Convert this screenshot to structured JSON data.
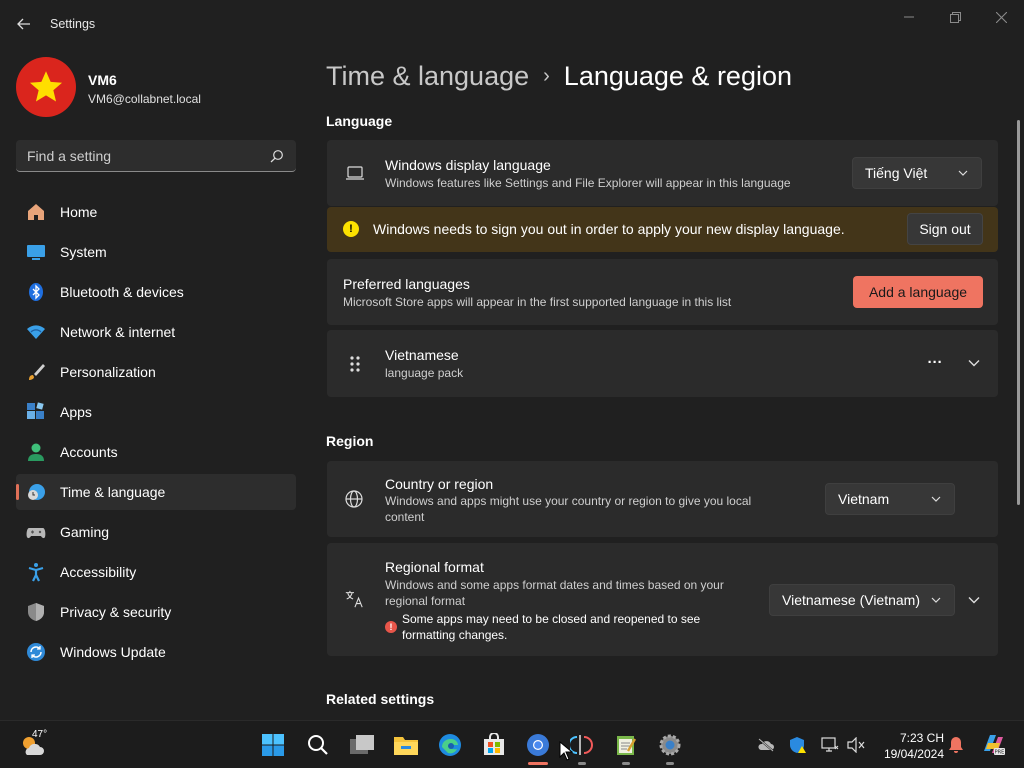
{
  "app": {
    "title": "Settings"
  },
  "user": {
    "name": "VM6",
    "email": "VM6@collabnet.local"
  },
  "search": {
    "placeholder": "Find a setting"
  },
  "sidebar": {
    "items": [
      {
        "label": "Home",
        "icon": "home-icon"
      },
      {
        "label": "System",
        "icon": "system-icon"
      },
      {
        "label": "Bluetooth & devices",
        "icon": "bluetooth-icon"
      },
      {
        "label": "Network & internet",
        "icon": "wifi-icon"
      },
      {
        "label": "Personalization",
        "icon": "brush-icon"
      },
      {
        "label": "Apps",
        "icon": "apps-icon"
      },
      {
        "label": "Accounts",
        "icon": "accounts-icon"
      },
      {
        "label": "Time & language",
        "icon": "time-language-icon",
        "active": true
      },
      {
        "label": "Gaming",
        "icon": "gaming-icon"
      },
      {
        "label": "Accessibility",
        "icon": "accessibility-icon"
      },
      {
        "label": "Privacy & security",
        "icon": "shield-icon"
      },
      {
        "label": "Windows Update",
        "icon": "update-icon"
      }
    ]
  },
  "breadcrumb": {
    "parent": "Time & language",
    "separator": "›",
    "current": "Language & region"
  },
  "language": {
    "section_title": "Language",
    "display": {
      "title": "Windows display language",
      "description": "Windows features like Settings and File Explorer will appear in this language",
      "value": "Tiếng Việt"
    },
    "warning": {
      "text": "Windows needs to sign you out in order to apply your new display language.",
      "button": "Sign out"
    },
    "preferred": {
      "title": "Preferred languages",
      "description": "Microsoft Store apps will appear in the first supported language in this list",
      "button": "Add a language"
    },
    "installed": [
      {
        "name": "Vietnamese",
        "detail": "language pack",
        "more": "···"
      }
    ]
  },
  "region": {
    "section_title": "Region",
    "country": {
      "title": "Country or region",
      "description_line1": "Windows and apps might use your country or region to give you local",
      "description_line2": "content",
      "value": "Vietnam"
    },
    "format": {
      "title": "Regional format",
      "description_line1": "Windows and some apps format dates and times based on your",
      "description_line2": "regional format",
      "notice_line1": "Some apps may need to be closed and reopened to see",
      "notice_line2": "formatting changes.",
      "value": "Vietnamese (Vietnam)"
    }
  },
  "related": {
    "section_title": "Related settings"
  },
  "taskbar": {
    "weather_temp": "47°",
    "time": "7:23 CH",
    "date": "19/04/2024"
  },
  "colors": {
    "accent": "#ef7461",
    "warning_bg": "#433519",
    "card_bg": "#2b2b2b"
  }
}
